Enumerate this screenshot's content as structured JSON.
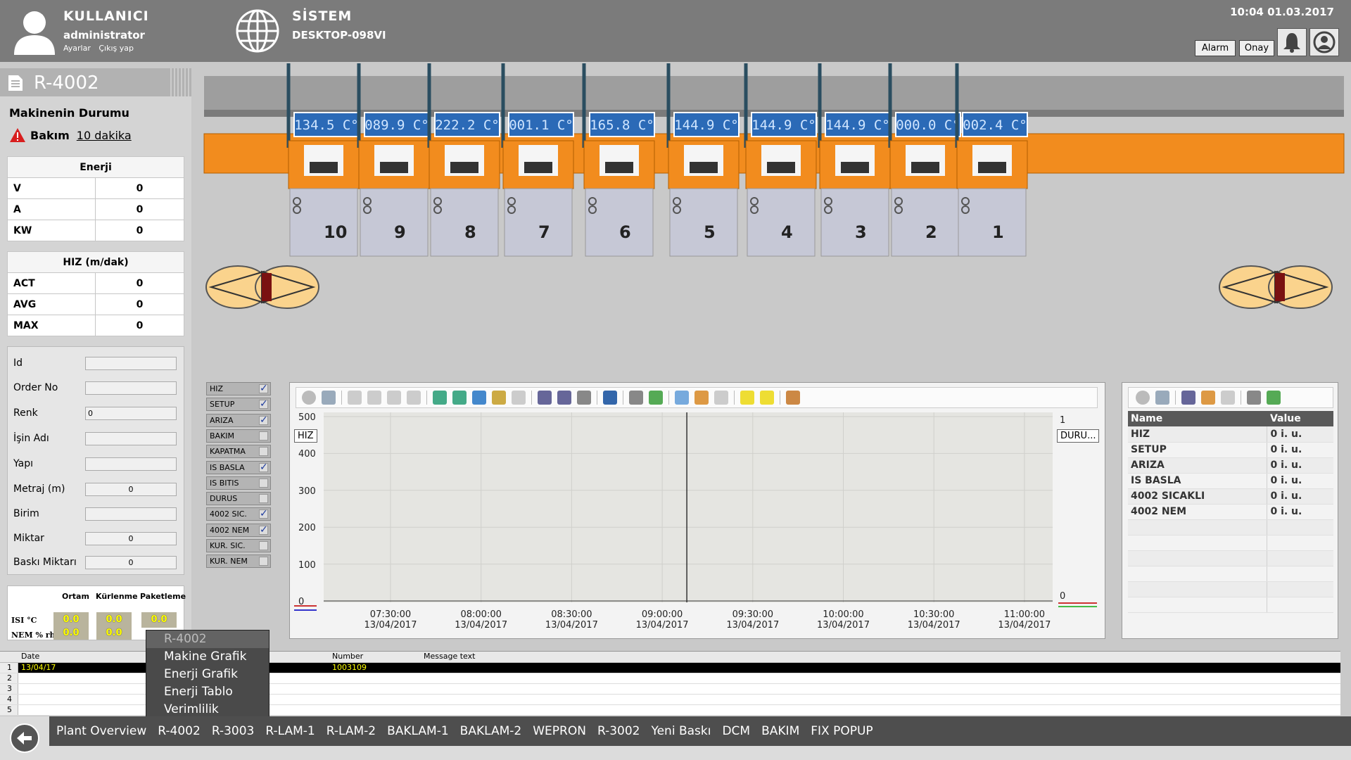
{
  "header": {
    "user_title": "KULLANICI",
    "user_name": "administrator",
    "user_links": [
      "Ayarlar",
      "Çıkış yap"
    ],
    "system_title": "SİSTEM",
    "system_name": "DESKTOP-098VI",
    "clock": "10:04  01.03.2017",
    "alarm_label": "Alarm",
    "onay_label": "Onay"
  },
  "left": {
    "machine_id": "R-4002",
    "status_heading": "Makinenin Durumu",
    "status_label": "Bakım",
    "status_duration": "10 dakika",
    "energy": {
      "title": "Enerji",
      "rows": [
        [
          "V",
          "0"
        ],
        [
          "A",
          "0"
        ],
        [
          "KW",
          "0"
        ]
      ]
    },
    "speed": {
      "title": "HIZ (m/dak)",
      "rows": [
        [
          "ACT",
          "0"
        ],
        [
          "AVG",
          "0"
        ],
        [
          "MAX",
          "0"
        ]
      ]
    },
    "form": [
      {
        "label": "Id",
        "value": ""
      },
      {
        "label": "Order No",
        "value": ""
      },
      {
        "label": "Renk",
        "value": "0"
      },
      {
        "label": "İşin Adı",
        "value": ""
      },
      {
        "label": "Yapı",
        "value": ""
      },
      {
        "label": "Metraj (m)",
        "value": "0"
      },
      {
        "label": "Birim",
        "value": ""
      },
      {
        "label": "Miktar",
        "value": "0"
      },
      {
        "label": "Baskı Miktarı",
        "value": "0"
      }
    ],
    "env": {
      "cols": [
        "Ortam",
        "Kürlenme",
        "Paketleme"
      ],
      "rows": [
        {
          "label": "ISI °C",
          "values": [
            "0.0",
            "0.0",
            "0.0"
          ]
        },
        {
          "label": "NEM % rh",
          "values": [
            "0.0",
            "0.0"
          ]
        }
      ]
    }
  },
  "machine": {
    "temps": [
      "134.5 C°",
      "089.9 C°",
      "222.2 C°",
      "001.1 C°",
      "165.8 C°",
      "144.9 C°",
      "144.9 C°",
      "144.9 C°",
      "000.0 C°",
      "002.4 C°"
    ],
    "units": [
      "10",
      "9",
      "8",
      "7",
      "6",
      "5",
      "4",
      "3",
      "2",
      "1"
    ]
  },
  "checkboxes": [
    {
      "label": "HIZ",
      "checked": true
    },
    {
      "label": "SETUP",
      "checked": true
    },
    {
      "label": "ARIZA",
      "checked": true
    },
    {
      "label": "BAKIM",
      "checked": false
    },
    {
      "label": "KAPATMA",
      "checked": false
    },
    {
      "label": "IS BASLA",
      "checked": true
    },
    {
      "label": "IS BITIS",
      "checked": false
    },
    {
      "label": "DURUS",
      "checked": false
    },
    {
      "label": "4002 SIC.",
      "checked": true
    },
    {
      "label": "4002 NEM",
      "checked": true
    },
    {
      "label": "KUR. SIC.",
      "checked": false
    },
    {
      "label": "KUR. NEM",
      "checked": false
    }
  ],
  "chart_data": {
    "type": "line",
    "y_left_label": "HIZ",
    "y_right_label": "DURU...",
    "y_left_ticks": [
      "500",
      "400",
      "300",
      "200",
      "100",
      "0"
    ],
    "y_right_ticks": [
      "1",
      "0"
    ],
    "ylim": [
      0,
      500
    ],
    "x_ticks": [
      [
        "07:30:00",
        "13/04/2017"
      ],
      [
        "08:00:00",
        "13/04/2017"
      ],
      [
        "08:30:00",
        "13/04/2017"
      ],
      [
        "09:00:00",
        "13/04/2017"
      ],
      [
        "09:30:00",
        "13/04/2017"
      ],
      [
        "10:00:00",
        "13/04/2017"
      ],
      [
        "10:30:00",
        "13/04/2017"
      ],
      [
        "11:00:00",
        "13/04/2017"
      ]
    ],
    "series": [],
    "cursor_time": "09:00:00"
  },
  "values_table": {
    "headers": [
      "Name",
      "Value"
    ],
    "rows": [
      [
        "HIZ",
        "0 i. u."
      ],
      [
        "SETUP",
        "0 i. u."
      ],
      [
        "ARIZA",
        "0 i. u."
      ],
      [
        "IS BASLA",
        "0 i. u."
      ],
      [
        "4002 SICAKLI",
        "0 i. u."
      ],
      [
        "4002 NEM",
        "0 i. u."
      ]
    ]
  },
  "messages": {
    "headers": [
      "Date",
      "Number",
      "Message text"
    ],
    "rows": [
      [
        "13/04/17",
        "1003109",
        ""
      ],
      [
        "",
        "",
        ""
      ],
      [
        "",
        "",
        ""
      ],
      [
        "",
        "",
        ""
      ],
      [
        "",
        "",
        ""
      ]
    ]
  },
  "popup": {
    "title": "R-4002",
    "items": [
      "Makine Grafik",
      "Enerji Grafik",
      "Enerji Tablo",
      "Verimlilik"
    ]
  },
  "nav": [
    "Plant Overview",
    "R-4002",
    "R-3003",
    "R-LAM-1",
    "R-LAM-2",
    "BAKLAM-1",
    "BAKLAM-2",
    "WEPRON",
    "R-3002",
    "Yeni Baskı",
    "DCM",
    "BAKIM",
    "FIX POPUP"
  ]
}
